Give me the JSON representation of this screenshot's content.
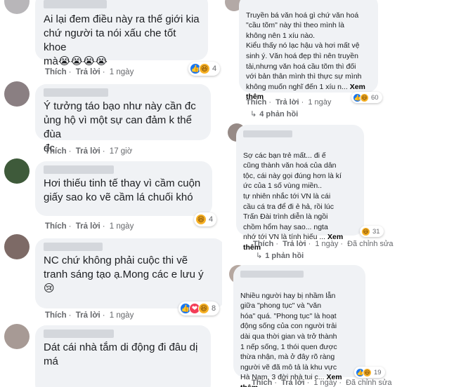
{
  "labels": {
    "like": "Thích",
    "reply": "Trả lời",
    "see_more": "Xem thêm",
    "edited": "Đã chỉnh sửa"
  },
  "left_comments": [
    {
      "text": "Ai lại đem điều này ra thế giới kia\nchứ người ta nói xấu che tốt khoe\nmà😭😭😭😭",
      "time": "1 ngày",
      "reactions": {
        "icons": [
          "like-icon",
          "haha-icon"
        ],
        "count": "4"
      }
    },
    {
      "text": "Ý tưởng táo bạo như này cần đc\nủng hộ vì một sự can đảm k thể đùa\nđc",
      "time": "17 giờ"
    },
    {
      "text": "Hơi thiếu tinh tế thay vì cầm cuộn\ngiấy sao ko vẽ cầm lá chuối khó",
      "time": "1 ngày",
      "reactions": {
        "icons": [
          "haha-icon"
        ],
        "count": "4"
      }
    },
    {
      "text": "NC chứ không phải cuộc thi vẽ\ntranh sáng tạo ạ.Mong các e lưu ý\n😢",
      "time": "1 ngày",
      "reactions": {
        "icons": [
          "like-icon",
          "love-icon",
          "haha-icon"
        ],
        "count": "8"
      }
    },
    {
      "text": "Dát cái nhà tắm di động đi đâu dị\nmá"
    }
  ],
  "right_comments": [
    {
      "text": "Truyền bá văn hoá gì chứ văn hoá\n\"cầu tõm\" này thì theo mình là\nkhông nên 1 xíu nào.\nKiểu thấy nó lạc hậu và hơi mất vệ\nsinh ý. Văn hoá đẹp thì nên truyền\ntải,nhưng văn hoá cầu tõm thì đối\nvới bản thân mình thì thực sự mình\nkhông muốn nghĩ đến 1 xíu n...",
      "time": "1 ngày",
      "reactions": {
        "icons": [
          "like-icon",
          "haha-icon"
        ],
        "count": "60"
      },
      "replies": "4 phản hồi"
    },
    {
      "text": "Sợ các bạn trẻ mất... đi ế\ncũng thành văn hoá của dân\ntộc, cái này gọi đúng hơn là kí\nức của 1 số vùng miền..\ntự nhiên nhắc tới VN là cái\ncầu cá tra để đi ẻ hả, rồi lúc\nTrấn Đài trình diễn là ngồi\nchồm hổm hay sao... ngta\nnhớ tới VN là tính hiếu ...",
      "time": "1 ngày",
      "edited": true,
      "reactions": {
        "icons": [
          "haha-icon"
        ],
        "count": "31"
      },
      "replies": "1 phản hồi"
    },
    {
      "text": "Nhiều người hay bị nhầm lẫn\ngiữa \"phong tục\" và \"văn\nhóa\" quá. \"Phong tục\" là hoạt\nđộng sống của con người trải\ndài qua thời gian và trở thành\n1 nếp sống, 1 thói quen được\nthừa nhận, mà ở đây rõ ràng\nngười vẽ đã mô tả là khu vực\nHà Nam. 3 đời nhà tui c...",
      "time": "1 ngày",
      "edited": true,
      "reactions": {
        "icons": [
          "like-icon",
          "haha-icon"
        ],
        "count": "19"
      }
    }
  ]
}
